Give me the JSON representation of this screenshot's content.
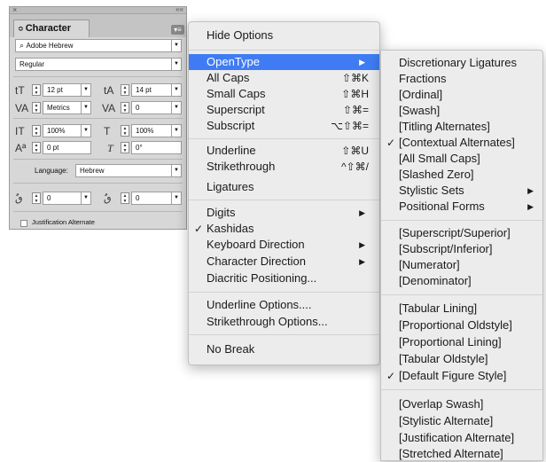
{
  "panel": {
    "close_glyph": "×",
    "collapse_glyph": "««",
    "tab_arrow": "≎",
    "tab_title": "Character",
    "tab_close": "",
    "menu_glyph": "▾≡",
    "font_family": "Adobe Hebrew",
    "font_style": "Regular",
    "font_size": "12 pt",
    "leading": "14 pt",
    "kerning": "Metrics",
    "tracking": "0",
    "vertical_scale": "100%",
    "horizontal_scale": "100%",
    "baseline_shift": "0 pt",
    "skew": "0°",
    "language_label": "Language:",
    "language": "Hebrew",
    "diacritic_x": "0",
    "diacritic_y": "0",
    "justification_alternate": "Justification Alternate"
  },
  "menu_main": {
    "items": [
      {
        "label": "Hide Options",
        "shortcut": ""
      },
      {
        "label": "OpenType",
        "shortcut": "",
        "submenu": "▶"
      },
      {
        "label": "All Caps",
        "shortcut": "⇧⌘K"
      },
      {
        "label": "Small Caps",
        "shortcut": "⇧⌘H"
      },
      {
        "label": "Superscript",
        "shortcut": "⇧⌘="
      },
      {
        "label": "Subscript",
        "shortcut": "⌥⇧⌘="
      },
      {
        "label": "Underline",
        "shortcut": "⇧⌘U"
      },
      {
        "label": "Strikethrough",
        "shortcut": "^⇧⌘/"
      },
      {
        "label": "Ligatures",
        "shortcut": ""
      },
      {
        "label": "Digits",
        "shortcut": "",
        "submenu": "▶"
      },
      {
        "label": "Kashidas",
        "shortcut": "",
        "check": "✓"
      },
      {
        "label": "Keyboard Direction",
        "shortcut": "",
        "submenu": "▶"
      },
      {
        "label": "Character Direction",
        "shortcut": "",
        "submenu": "▶"
      },
      {
        "label": "Diacritic Positioning...",
        "shortcut": ""
      },
      {
        "label": "Underline Options....",
        "shortcut": ""
      },
      {
        "label": "Strikethrough Options...",
        "shortcut": ""
      },
      {
        "label": "No Break",
        "shortcut": ""
      }
    ]
  },
  "menu_opentype": {
    "items": [
      {
        "label": "Discretionary Ligatures"
      },
      {
        "label": "Fractions"
      },
      {
        "label": "[Ordinal]"
      },
      {
        "label": "[Swash]"
      },
      {
        "label": "[Titling Alternates]"
      },
      {
        "label": "[Contextual Alternates]",
        "check": "✓"
      },
      {
        "label": "[All Small Caps]"
      },
      {
        "label": "[Slashed Zero]"
      },
      {
        "label": "Stylistic Sets",
        "submenu": "▶"
      },
      {
        "label": "Positional Forms",
        "submenu": "▶"
      },
      {
        "label": "[Superscript/Superior]"
      },
      {
        "label": "[Subscript/Inferior]"
      },
      {
        "label": "[Numerator]"
      },
      {
        "label": "[Denominator]"
      },
      {
        "label": "[Tabular Lining]"
      },
      {
        "label": "[Proportional Oldstyle]"
      },
      {
        "label": "[Proportional Lining]"
      },
      {
        "label": "[Tabular Oldstyle]"
      },
      {
        "label": "[Default Figure Style]",
        "check": "✓"
      },
      {
        "label": "[Overlap Swash]"
      },
      {
        "label": "[Stylistic Alternate]"
      },
      {
        "label": "[Justification Alternate]"
      },
      {
        "label": "[Stretched Alternate]"
      }
    ]
  },
  "colors": {
    "highlight": "#3f7cf4",
    "menu_bg": "#ececec",
    "panel_bg": "#d7d7d7"
  }
}
